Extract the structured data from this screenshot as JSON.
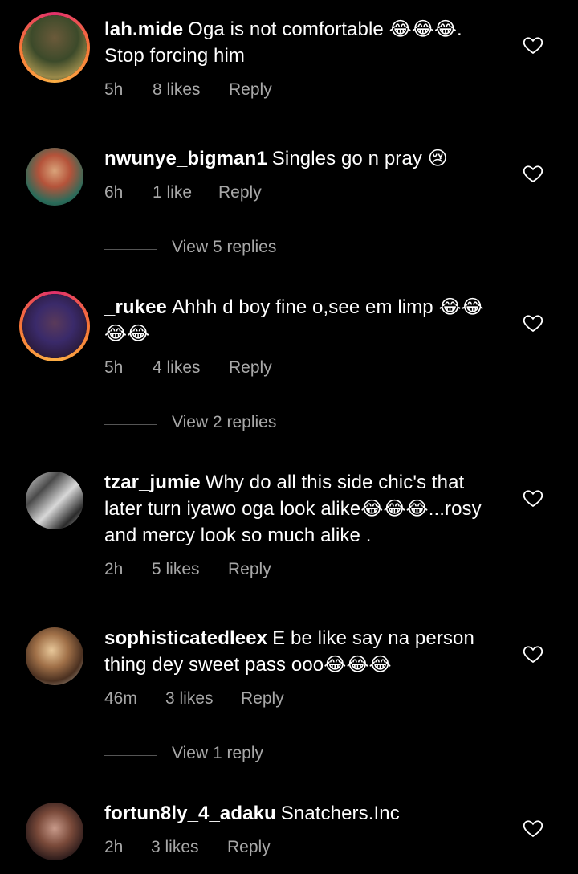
{
  "comments": [
    {
      "username": "lah.mide",
      "text": "Oga is not comfortable 😂😂😂. Stop forcing him",
      "time": "5h",
      "likes": "8 likes",
      "reply": "Reply",
      "ring": true
    },
    {
      "username": "nwunye_bigman1",
      "text": "Singles go n pray 😢",
      "time": "6h",
      "likes": "1 like",
      "reply": "Reply",
      "view_replies": "View 5 replies",
      "ring": false
    },
    {
      "username": "_rukee",
      "text": "Ahhh d boy fine o,see em limp 😂😂😂😂",
      "time": "5h",
      "likes": "4 likes",
      "reply": "Reply",
      "view_replies": "View 2 replies",
      "ring": true
    },
    {
      "username": "tzar_jumie",
      "text": "Why do all this side chic's that later turn iyawo oga look alike😂😂😂...rosy and mercy look so much alike .",
      "time": "2h",
      "likes": "5 likes",
      "reply": "Reply",
      "ring": false
    },
    {
      "username": "sophisticatedleex",
      "text": "E be like say na person thing dey sweet pass ooo😂😂😂",
      "time": "46m",
      "likes": "3 likes",
      "reply": "Reply",
      "view_replies": "View 1 reply",
      "ring": false
    },
    {
      "username": "fortun8ly_4_adaku",
      "text": "Snatchers.Inc",
      "time": "2h",
      "likes": "3 likes",
      "reply": "Reply",
      "ring": false
    }
  ]
}
